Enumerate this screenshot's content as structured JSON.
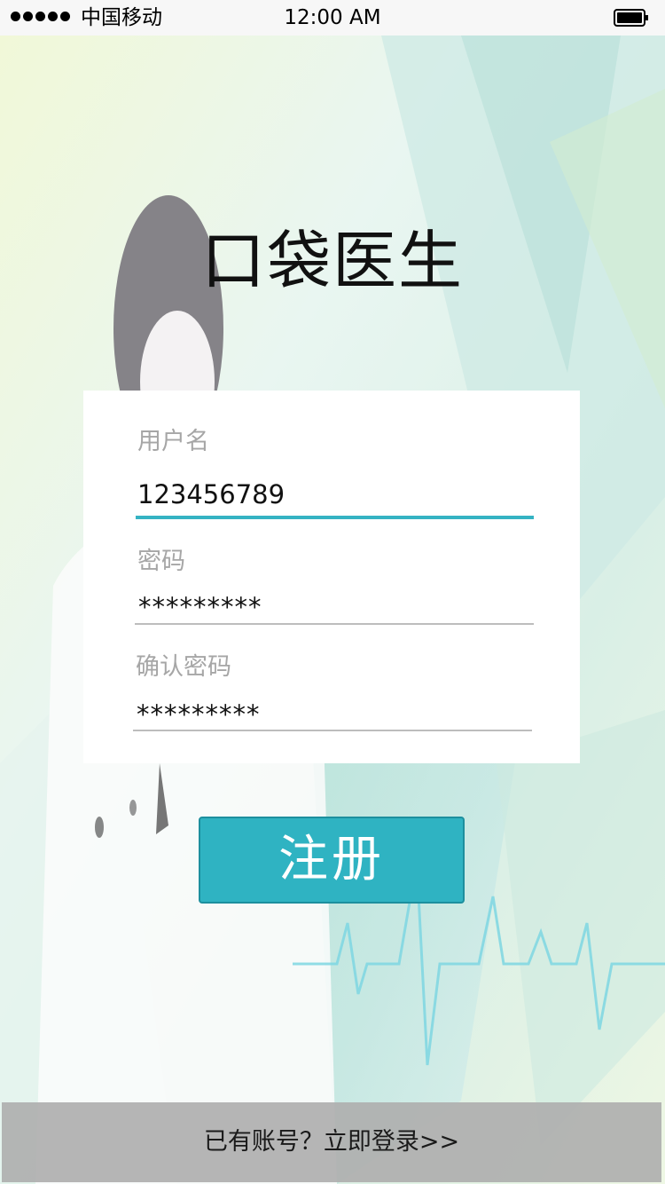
{
  "status_bar": {
    "carrier": "中国移动",
    "time": "12:00 AM",
    "signal_icon": "signal-dots-icon",
    "battery_icon": "battery-icon"
  },
  "app": {
    "title": "口袋医生"
  },
  "form": {
    "username": {
      "label": "用户名",
      "value": "123456789"
    },
    "password": {
      "label": "密码",
      "value": "*********"
    },
    "confirm_password": {
      "label": "确认密码",
      "value": "*********"
    }
  },
  "register_button": {
    "label": "注册"
  },
  "footer": {
    "login_link": "已有账号？立即登录>>"
  },
  "colors": {
    "accent": "#2fb3c2",
    "input_active_line": "#35b3c3",
    "placeholder": "#a6a6a6",
    "footer_bg": "#afafaf"
  }
}
